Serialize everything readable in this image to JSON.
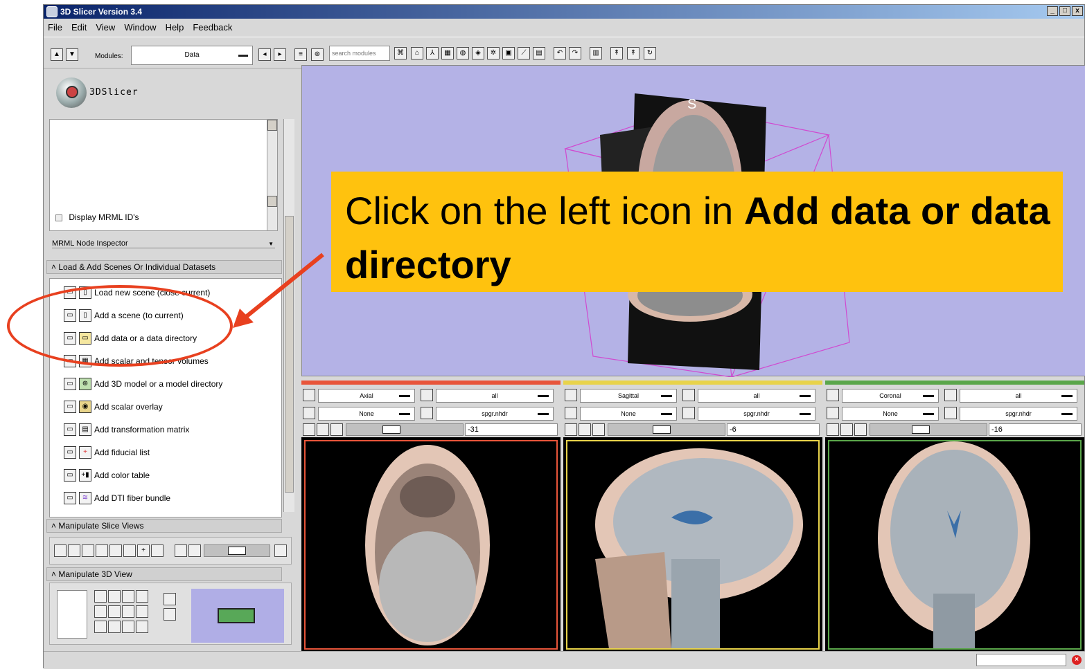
{
  "window": {
    "title": "3D Slicer Version 3.4",
    "controls": [
      "_",
      "□",
      "x"
    ]
  },
  "menu": [
    "File",
    "Edit",
    "View",
    "Window",
    "Help",
    "Feedback"
  ],
  "toolbar": {
    "modules_label": "Modules:",
    "module_selected": "Data",
    "search_placeholder": "search modules"
  },
  "logo_text": "3DSlicer",
  "mrml": {
    "display_ids_label": "Display MRML ID's",
    "inspector_label": "MRML Node Inspector"
  },
  "load_section": {
    "title": "Load & Add Scenes Or Individual Datasets",
    "items": [
      "Load new scene (close current)",
      "Add a scene (to current)",
      "Add data or a data directory",
      "Add scalar and tensor volumes",
      "Add 3D model or a model directory",
      "Add scalar overlay",
      "Add transformation matrix",
      "Add fiducial list",
      "Add color table",
      "Add DTI fiber bundle"
    ]
  },
  "slice_views_section": {
    "title": "Manipulate Slice Views"
  },
  "view3d_section": {
    "title": "Manipulate 3D View"
  },
  "view3d": {
    "orientation_label": "S"
  },
  "slices": [
    {
      "name": "Axial",
      "color": "#e8553a",
      "layer": "all",
      "fg": "None",
      "bg": "spgr.nhdr",
      "offset": "-31"
    },
    {
      "name": "Sagittal",
      "color": "#e8d34a",
      "layer": "all",
      "fg": "None",
      "bg": "spgr.nhdr",
      "offset": "-6"
    },
    {
      "name": "Coronal",
      "color": "#5aa64a",
      "layer": "all",
      "fg": "None",
      "bg": "spgr.nhdr",
      "offset": "-16"
    }
  ],
  "callout": {
    "text_plain": "Click on the left icon in ",
    "text_bold": "Add data or data directory"
  },
  "colors": {
    "callout_bg": "#ffc20e",
    "annotation": "#e8401f",
    "view3d_bg": "#b4b2e6"
  }
}
